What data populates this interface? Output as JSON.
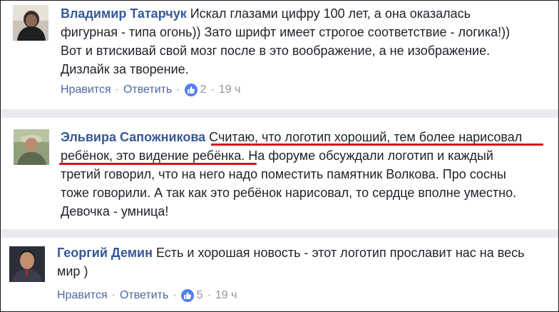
{
  "comments": [
    {
      "author": "Владимир Татарчук",
      "lines_after_author": [
        " Искал глазами цифру 100 лет, а она оказалась"
      ],
      "lines": [
        "фигурная - типа огонь)) Зато шрифт имеет строгое соответствие - логика!))",
        "Вот и втискивай свой мозг после в это воображение, а не изображение.",
        "Дизлайк за творение."
      ],
      "like_label": "Нравится",
      "reply_label": "Ответить",
      "reactions": "2",
      "time": "19 ч"
    },
    {
      "author": "Эльвира Сапожникова",
      "lines_after_author": [
        " Считаю, что логотип хороший, тем более нарисовал"
      ],
      "lines": [
        "ребёнок, это видение ребёнка. На форуме обсуждали логотип и каждый",
        "третий говорил, что на него надо поместить памятник Волкова. Про сосны",
        "тоже говорили. А так как это ребёнок нарисовал, то сердце вполне уместно.",
        "Девочка - умница!"
      ]
    },
    {
      "author": "Георгий Демин",
      "lines_after_author": [
        " Есть и хорошая новость - этот логотип прославит нас на весь"
      ],
      "lines": [
        "мир )"
      ],
      "like_label": "Нравится",
      "reply_label": "Ответить",
      "reactions": "5",
      "time": "19 ч"
    }
  ],
  "colors": {
    "author": "#365899",
    "text": "#1d2129",
    "meta": "#90949c",
    "like_badge": "#4f7ff2",
    "highlight_underline": "#d6141b",
    "separator": "#e9ebee"
  },
  "icons": [
    "user-avatar-icon",
    "like-thumb-icon"
  ]
}
